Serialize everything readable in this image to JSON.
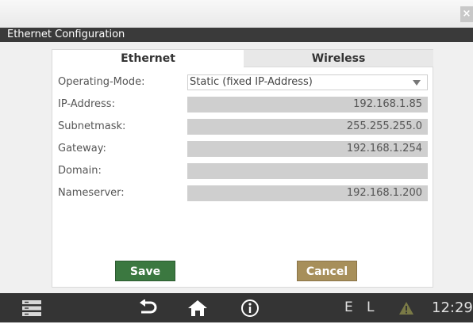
{
  "window": {
    "close_glyph": "×",
    "title": "Ethernet Configuration"
  },
  "tabs": [
    {
      "label": "Ethernet",
      "active": true
    },
    {
      "label": "Wireless",
      "active": false
    }
  ],
  "form": {
    "operating_mode": {
      "label": "Operating-Mode:",
      "value": "Static (fixed IP-Address)"
    },
    "ip_address": {
      "label": "IP-Address:",
      "value": "192.168.1.85"
    },
    "subnetmask": {
      "label": "Subnetmask:",
      "value": "255.255.255.0"
    },
    "gateway": {
      "label": "Gateway:",
      "value": "192.168.1.254"
    },
    "domain": {
      "label": "Domain:",
      "value": ""
    },
    "nameserver": {
      "label": "Nameserver:",
      "value": "192.168.1.200"
    }
  },
  "buttons": {
    "save": "Save",
    "cancel": "Cancel"
  },
  "navbar": {
    "icons": [
      "menu-icon",
      "back-icon",
      "home-icon",
      "info-icon",
      "warning-icon"
    ],
    "status_e": "E",
    "status_l": "L",
    "time": "12:29"
  },
  "colors": {
    "save": "#3b7840",
    "cancel": "#a78f5a",
    "navbar": "#343434",
    "warning": "#7a7a46"
  }
}
